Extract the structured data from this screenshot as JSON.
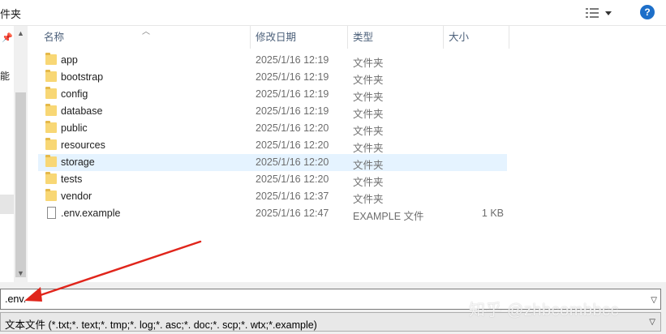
{
  "header": {
    "title_fragment": "件夹",
    "view_icon": "details-view-icon",
    "help_label": "?"
  },
  "nav": {
    "text_fragment": "能"
  },
  "columns": {
    "name": "名称",
    "date": "修改日期",
    "type": "类型",
    "size": "大小"
  },
  "files": [
    {
      "name": "app",
      "date": "2025/1/16 12:19",
      "type": "文件夹",
      "size": "",
      "icon": "folder-icon"
    },
    {
      "name": "bootstrap",
      "date": "2025/1/16 12:19",
      "type": "文件夹",
      "size": "",
      "icon": "folder-icon"
    },
    {
      "name": "config",
      "date": "2025/1/16 12:19",
      "type": "文件夹",
      "size": "",
      "icon": "folder-icon"
    },
    {
      "name": "database",
      "date": "2025/1/16 12:19",
      "type": "文件夹",
      "size": "",
      "icon": "folder-icon"
    },
    {
      "name": "public",
      "date": "2025/1/16 12:20",
      "type": "文件夹",
      "size": "",
      "icon": "folder-icon"
    },
    {
      "name": "resources",
      "date": "2025/1/16 12:20",
      "type": "文件夹",
      "size": "",
      "icon": "folder-icon"
    },
    {
      "name": "storage",
      "date": "2025/1/16 12:20",
      "type": "文件夹",
      "size": "",
      "icon": "folder-icon"
    },
    {
      "name": "tests",
      "date": "2025/1/16 12:20",
      "type": "文件夹",
      "size": "",
      "icon": "folder-icon"
    },
    {
      "name": "vendor",
      "date": "2025/1/16 12:37",
      "type": "文件夹",
      "size": "",
      "icon": "folder-icon"
    },
    {
      "name": ".env.example",
      "date": "2025/1/16 12:47",
      "type": "EXAMPLE 文件",
      "size": "1 KB",
      "icon": "file-icon"
    }
  ],
  "filename_field": {
    "value": ".env."
  },
  "filetype_select": {
    "selected": "文本文件 (*.txt;*. text;*. tmp;*. log;*. asc;*. doc;*. scp;*. wtx;*.example)"
  },
  "watermark": "知乎 @zhbcombbcc",
  "colors": {
    "accent": "#1d6fc9",
    "hover_row": "#e5f3ff",
    "folder": "#f8d775",
    "annotation_arrow": "#e0251b"
  }
}
